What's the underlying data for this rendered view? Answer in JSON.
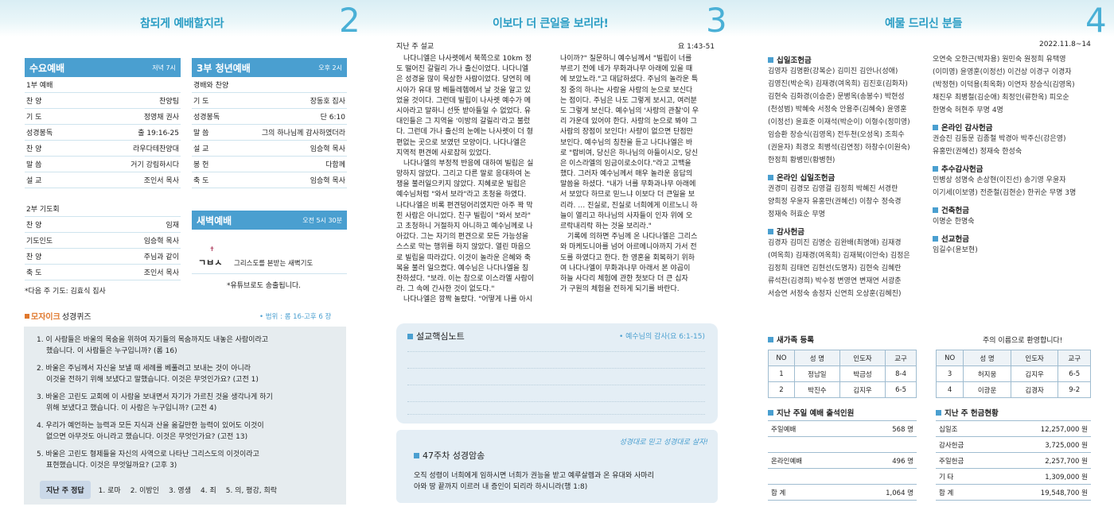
{
  "p1": {
    "title": "참되게 예배할지라",
    "num": "2",
    "wed": {
      "title": "수요예배",
      "time": "저녁 7시",
      "sub": "1부 예배",
      "rows": [
        [
          "찬 양",
          "찬양팀"
        ],
        [
          "기 도",
          "정영채 권사"
        ],
        [
          "성경봉독",
          "출 19:16-25"
        ],
        [
          "찬 양",
          "라우다테찬양대"
        ],
        [
          "말 씀",
          "거기 강림하시다"
        ],
        [
          "설 교",
          "조인서 목사"
        ]
      ],
      "sub2": "2부 기도회",
      "rows2": [
        [
          "찬 양",
          "임재"
        ],
        [
          "기도인도",
          "임승혁 목사"
        ],
        [
          "찬 양",
          "주님과 같이"
        ],
        [
          "축 도",
          "조인서 목사"
        ]
      ],
      "note": "*다음 주 기도: 김효식 집사"
    },
    "youth": {
      "title": "3부 청년예배",
      "time": "오후 2시",
      "rows": [
        [
          "경배와 찬양",
          ""
        ],
        [
          "기 도",
          "장동호 집사"
        ],
        [
          "성경봉독",
          "단 6:10"
        ],
        [
          "말 씀",
          "그의 하나님께 감사하였더라"
        ],
        [
          "설 교",
          "임승혁 목사"
        ],
        [
          "봉 헌",
          "다함께"
        ],
        [
          "축 도",
          "임승혁 목사"
        ]
      ]
    },
    "dawn": {
      "title": "새벽예배",
      "time": "오전 5시 30분",
      "logo1": "ㄱㅂㅅ",
      "logo2": "그리스도를 본받는 새벽기도",
      "note": "*유튜브로도 송출됩니다."
    },
    "quiz": {
      "tag1": "모자이크",
      "tag2": "성경퀴즈",
      "range": "• 범위 : 롬 16-고후 6 장",
      "items": [
        [
          "1. 이 사람들은 바울의 목숨을 위하여 자기들의 목숨까지도 내놓은 사람이라고",
          "했습니다. 이 사람들은 누구입니까? (롬 16)"
        ],
        [
          "2. 바울은 주님께서 자신을 보낼 때 세례를 베풀려고 보내는 것이 아니라",
          "이것을 전하기 위해 보냈다고 말했습니다. 이것은 무엇인가요? (고전 1)"
        ],
        [
          "3. 바울은 고린도 교회에 이 사람을 보내면서 자기가 가르친 것을 생각나게 하기",
          "위해 보냈다고 했습니다. 이 사람은 누구입니까? (고전 4)"
        ],
        [
          "4. 우리가 예언하는 능력과 모든 지식과 산을 옮길만한 능력이 있어도 이것이",
          "없으면 아무것도 아니라고 했습니다. 이것은 무엇인가요? (고전 13)"
        ],
        [
          "5. 바울은 고린도 형제들을 자신의 사역으로 나타난 그리스도의 이것이라고",
          "표현했습니다. 이것은 무엇일까요? (고후 3)"
        ]
      ],
      "ans_label": "지난 주 정답",
      "answers": [
        "1. 로마",
        "2. 이방인",
        "3. 영생",
        "4. 죄",
        "5. 의, 평강, 희락"
      ]
    }
  },
  "p2": {
    "title": "이보다 더 큰일을 보리라!",
    "num": "3",
    "head_left": "지난 주 설교",
    "head_right": "요 1:43-51",
    "col1": [
      "나다니엘은 나사렛에서 북쪽으로 10km 정",
      "도 떨어진 갈릴리 가나 출신이었다. 나다니엘",
      "은 성경을 많이 묵상한 사람이었다. 당연히 메",
      "시아가 유대 땅 베들레헴에서 날 것을 알고 있",
      "었을 것이다. 그런데 빌립이 나사렛 예수가 메",
      "시아라고 말하니 선뜻 받아들일 수 없었다. 유",
      "대인들은 그 지역을 '이방의 갈릴리'라고 불렀",
      "다. 그런데 가나 출신의 눈에는 나사렛이 더 형",
      "편없는 곳으로 보였던 모양이다. 나다나엘은",
      "지역적 편견에 사로잡혀 있었다.",
      "나다나엘의 부정적 반응에 대하여 빌립은 실",
      "망하지 않았다. 그리고 다른 말로 응대하여 논",
      "쟁을 불러일으키지 않았다. 지혜로운 빌립은",
      "예수님처럼 \"와서 보라\"라고 초청을 하였다.",
      "나다나엘은 비록 편견덩어리였지만 아주 꽉 막",
      "힌 사람은 아니었다. 친구 빌립이 \"와서 보라\"",
      "고 초청하니 거절하지 아니하고 예수님께로 나",
      "아갔다. 그는 자기의 편견으로 모든 가능성을",
      "스스로 막는 행위를 하지 않았다. 열린 마음으",
      "로 빌립을 따라갔다. 이것이 놀라운 은혜와 축",
      "복을 불러 일으켰다. 예수님은 나다나엘을 칭",
      "찬하셨다. \"보라. 이는 참으로 이스라엘 사람이",
      "라. 그 속에 간사한 것이 없도다.\"",
      "나다나엘은 깜짝 놀랐다. \"어떻게 나를 아시"
    ],
    "col2": [
      "나이까?\" 질문하니 예수님께서 \"빌립이 너를",
      "부르기 전에 네가 무화과나무 아래에 있을 때",
      "에 보았노라.\"고 대답하셨다. 주님의 놀라운 특",
      "징 중의 하나는 사랑을 사랑의 눈으로 보신다",
      "는 점이다. 주님은 나도 그렇게 보시고, 여러분",
      "도 그렇게 보신다. 예수님의 '사랑의 관찰'이 우",
      "리 가운데 있어야 한다. 사랑의 눈으로 봐야 그",
      "사람의 장점이 보인다! 사랑이 없으면 단점만",
      "보인다. 예수님의 칭찬을 듣고 나다나엘은 바",
      "로 \"랍비여, 당신은 하나님의 아들이시오, 당신",
      "은 이스라엘의 임금이로소이다.\"라고 고백을",
      "했다. 그러자 예수님께서 매우 놀라운 응답의",
      "말씀을 하셨다. \"내가 너를 무화과나무 아래에",
      "서 보았다 하므로 믿느냐 이보다 더 큰일을 보",
      "리라. … 진실로, 진실로 너희에게 이르노니 하",
      "늘이 열리고 하나님의 사자들이 인자 위에 오",
      "르락내리락 하는 것을 보리라.\"",
      "기록에 의하면 주님께 온 나다나엘은 그리스",
      "와 마케도니아를 넘어 아르메니아까지 가서 전",
      "도를 하였다고 한다. 한 영혼을 회복하기 위하",
      "여 나다나엘이 무화과나무 아래서 본 야곱이",
      "하늘 사다리 체험에 관한 첫보다 더 큰 십자",
      "가 구원의 체험을 전하게 되기를 바란다."
    ],
    "note_title": "설교핵심노트",
    "note_ref": "• 예수님의 감사(요 6:1-15)",
    "memo_tag": "성경대로 믿고 성경대로 살자!",
    "memo_title": "47주차 성경암송",
    "memo_text": [
      "오직 성령이 너희에게 임하시면 너희가 권능을 받고 예루살렘과 온 유대와 사마리",
      "아와 땅 끝까지 이르러 내 증인이 되리라 하시니라(행 1:8)"
    ]
  },
  "p3": {
    "title": "예물 드리신 분들",
    "num": "4",
    "date": "2022.11.8~14",
    "g1": {
      "title": "십일조헌금",
      "lines": [
        "김영자 김명환(강복순) 김미진 김안나(성애)",
        "김영진(박순옥) 김재경(여옥희) 김진호(김화자)",
        "김현숙 김화경(이승준) 문병옥(송봉수) 박현성",
        "(천성범) 박혜숙 서정숙 안용주(김혜숙) 윤영훈",
        "(이정선) 윤효준 이재석(박순이) 이형수(정미영)",
        "임승환 장승식(김영옥) 전두천(오성옥) 조희수",
        "(권윤자) 최경오 최병석(김연정) 하창수(이원숙)",
        "한정희 황병민(황병현)"
      ]
    },
    "g2": {
      "title": "온라인 십일조헌금",
      "lines": [
        "권경미 김경모 김영걸 김정희 박혜진 서경란",
        "양희정 우윤자 유홍만(권혜선) 이창수 정숙경",
        "정재숙 허효순 무명"
      ]
    },
    "g3": {
      "title": "감사헌금",
      "lines": [
        "김경자 김미진 김명순 김완배(최명애) 김재경",
        "(여옥희) 김재경(여옥희) 김재북(이안숙) 김정은",
        "김정희 김태연 김현선(도명자) 김현숙 김혜란",
        "류석찬(김경희) 박수정 변영연 변재연 서광춘",
        "서승연 서정숙 송정자 신연희 오상훈(김혜진)"
      ]
    },
    "g1b": [
      "오연숙 오한근(박자용) 원민숙 원정희 유택영",
      "(이미영) 윤영훈(이정선) 이건상 이경구 이경자",
      "(박정현) 이덕용(최옥화) 이연자 장승식(김영옥)",
      "채진우 최병철(김순애) 최정인(류한옥) 피오순",
      "한명숙 허현주 무명 4명"
    ],
    "g4": {
      "title": "온라인 감사헌금",
      "lines": [
        "권승진 김동문 김종철 박경아 박주신(강은영)",
        "유홍만(권혜선) 정재숙 한성숙"
      ]
    },
    "g5": {
      "title": "추수감사헌금",
      "lines": [
        "민병상 성명숙 손상현(이진선) 송기영 우윤자",
        "이기세(이보영) 전준철(김현순) 한귀순 무명 3명"
      ]
    },
    "g6": {
      "title": "건축헌금",
      "lines": [
        "이명순 한명숙"
      ]
    },
    "g7": {
      "title": "선교헌금",
      "lines": [
        "임길수(윤보현)"
      ]
    },
    "newc": {
      "title": "새가족 등록",
      "welcome": "주의 이름으로 환영합니다!",
      "headers": [
        "NO",
        "성 명",
        "인도자",
        "교구"
      ],
      "left": [
        [
          "1",
          "정남일",
          "박금성",
          "8-4"
        ],
        [
          "2",
          "박진수",
          "김지우",
          "6-5"
        ]
      ],
      "right": [
        [
          "3",
          "허지웅",
          "김지우",
          "6-5"
        ],
        [
          "4",
          "이광운",
          "김경자",
          "9-2"
        ]
      ]
    },
    "att": {
      "title": "지난 주일 예배 출석인원",
      "rows": [
        [
          "주일예배",
          "568 명"
        ],
        [
          "온라인예배",
          "496 명"
        ],
        [
          "합 계",
          "1,064 명"
        ]
      ]
    },
    "off": {
      "title": "지난 주 헌금현황",
      "rows": [
        [
          "십일조",
          "12,257,000 원"
        ],
        [
          "감사헌금",
          "3,725,000 원"
        ],
        [
          "주일헌금",
          "2,257,700 원"
        ],
        [
          "기 타",
          "1,309,000 원"
        ],
        [
          "합 계",
          "19,548,700 원"
        ]
      ]
    }
  }
}
